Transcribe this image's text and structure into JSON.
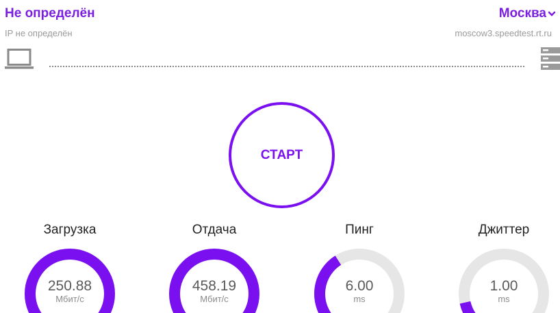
{
  "header": {
    "isp_name": "Не определён",
    "ip_text": "IP не определён",
    "city": "Москва",
    "server_host": "moscow3.speedtest.rt.ru"
  },
  "start_button": {
    "label": "СТАРТ"
  },
  "colors": {
    "accent": "#7a10f0",
    "track": "#e6e6e6"
  },
  "metrics": [
    {
      "title": "Загрузка",
      "value": "250.88",
      "unit": "Мбит/с",
      "fill_fraction": 1.0
    },
    {
      "title": "Отдача",
      "value": "458.19",
      "unit": "Мбит/с",
      "fill_fraction": 1.0
    },
    {
      "title": "Пинг",
      "value": "6.00",
      "unit": "ms",
      "fill_fraction": 0.38
    },
    {
      "title": "Джиттер",
      "value": "1.00",
      "unit": "ms",
      "fill_fraction": 0.12
    }
  ]
}
